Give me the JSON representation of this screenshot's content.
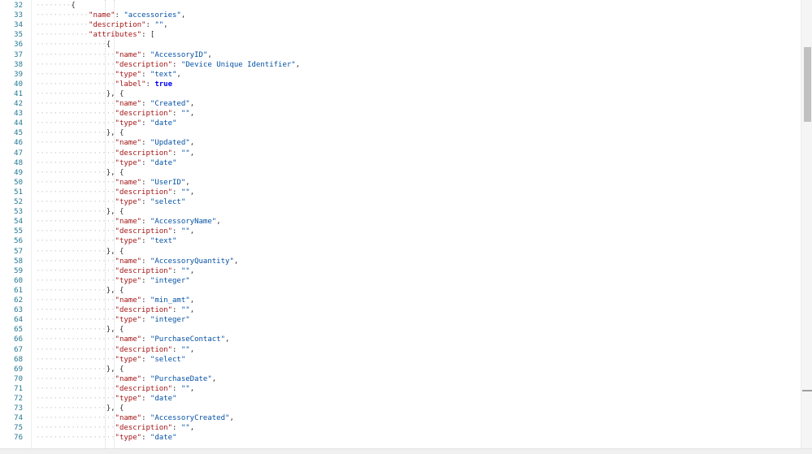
{
  "editor": {
    "lines": [
      {
        "n": "32",
        "indent": 8,
        "parts": [
          {
            "t": "p",
            "v": "{"
          }
        ]
      },
      {
        "n": "33",
        "indent": 12,
        "parts": [
          {
            "t": "k",
            "v": "\"name\""
          },
          {
            "t": "p",
            "v": ": "
          },
          {
            "t": "s",
            "v": "\"accessories\""
          },
          {
            "t": "p",
            "v": ","
          }
        ]
      },
      {
        "n": "34",
        "indent": 12,
        "parts": [
          {
            "t": "k",
            "v": "\"description\""
          },
          {
            "t": "p",
            "v": ": "
          },
          {
            "t": "s",
            "v": "\"\""
          },
          {
            "t": "p",
            "v": ","
          }
        ]
      },
      {
        "n": "35",
        "indent": 12,
        "parts": [
          {
            "t": "k",
            "v": "\"attributes\""
          },
          {
            "t": "p",
            "v": ": ["
          }
        ]
      },
      {
        "n": "36",
        "indent": 16,
        "parts": [
          {
            "t": "p",
            "v": "{"
          }
        ]
      },
      {
        "n": "37",
        "indent": 18,
        "parts": [
          {
            "t": "k",
            "v": "\"name\""
          },
          {
            "t": "p",
            "v": ": "
          },
          {
            "t": "s",
            "v": "\"AccessoryID\""
          },
          {
            "t": "p",
            "v": ","
          }
        ]
      },
      {
        "n": "38",
        "indent": 18,
        "parts": [
          {
            "t": "k",
            "v": "\"description\""
          },
          {
            "t": "p",
            "v": ": "
          },
          {
            "t": "s",
            "v": "\"Device Unique Identifier\""
          },
          {
            "t": "p",
            "v": ","
          }
        ]
      },
      {
        "n": "39",
        "indent": 18,
        "parts": [
          {
            "t": "k",
            "v": "\"type\""
          },
          {
            "t": "p",
            "v": ": "
          },
          {
            "t": "s",
            "v": "\"text\""
          },
          {
            "t": "p",
            "v": ","
          }
        ]
      },
      {
        "n": "40",
        "indent": 18,
        "parts": [
          {
            "t": "k",
            "v": "\"label\""
          },
          {
            "t": "p",
            "v": ": "
          },
          {
            "t": "b",
            "v": "true"
          }
        ]
      },
      {
        "n": "41",
        "indent": 16,
        "parts": [
          {
            "t": "p",
            "v": "}, {"
          }
        ]
      },
      {
        "n": "42",
        "indent": 18,
        "parts": [
          {
            "t": "k",
            "v": "\"name\""
          },
          {
            "t": "p",
            "v": ": "
          },
          {
            "t": "s",
            "v": "\"Created\""
          },
          {
            "t": "p",
            "v": ","
          }
        ]
      },
      {
        "n": "43",
        "indent": 18,
        "parts": [
          {
            "t": "k",
            "v": "\"description\""
          },
          {
            "t": "p",
            "v": ": "
          },
          {
            "t": "s",
            "v": "\"\""
          },
          {
            "t": "p",
            "v": ","
          }
        ]
      },
      {
        "n": "44",
        "indent": 18,
        "parts": [
          {
            "t": "k",
            "v": "\"type\""
          },
          {
            "t": "p",
            "v": ": "
          },
          {
            "t": "s",
            "v": "\"date\""
          }
        ]
      },
      {
        "n": "45",
        "indent": 16,
        "parts": [
          {
            "t": "p",
            "v": "}, {"
          }
        ]
      },
      {
        "n": "46",
        "indent": 18,
        "parts": [
          {
            "t": "k",
            "v": "\"name\""
          },
          {
            "t": "p",
            "v": ": "
          },
          {
            "t": "s",
            "v": "\"Updated\""
          },
          {
            "t": "p",
            "v": ","
          }
        ]
      },
      {
        "n": "47",
        "indent": 18,
        "parts": [
          {
            "t": "k",
            "v": "\"description\""
          },
          {
            "t": "p",
            "v": ": "
          },
          {
            "t": "s",
            "v": "\"\""
          },
          {
            "t": "p",
            "v": ","
          }
        ]
      },
      {
        "n": "48",
        "indent": 18,
        "parts": [
          {
            "t": "k",
            "v": "\"type\""
          },
          {
            "t": "p",
            "v": ": "
          },
          {
            "t": "s",
            "v": "\"date\""
          }
        ]
      },
      {
        "n": "49",
        "indent": 16,
        "parts": [
          {
            "t": "p",
            "v": "}, {"
          }
        ]
      },
      {
        "n": "50",
        "indent": 18,
        "parts": [
          {
            "t": "k",
            "v": "\"name\""
          },
          {
            "t": "p",
            "v": ": "
          },
          {
            "t": "s",
            "v": "\"UserID\""
          },
          {
            "t": "p",
            "v": ","
          }
        ]
      },
      {
        "n": "51",
        "indent": 18,
        "parts": [
          {
            "t": "k",
            "v": "\"description\""
          },
          {
            "t": "p",
            "v": ": "
          },
          {
            "t": "s",
            "v": "\"\""
          },
          {
            "t": "p",
            "v": ","
          }
        ]
      },
      {
        "n": "52",
        "indent": 18,
        "parts": [
          {
            "t": "k",
            "v": "\"type\""
          },
          {
            "t": "p",
            "v": ": "
          },
          {
            "t": "s",
            "v": "\"select\""
          }
        ]
      },
      {
        "n": "53",
        "indent": 16,
        "parts": [
          {
            "t": "p",
            "v": "}, {"
          }
        ]
      },
      {
        "n": "54",
        "indent": 18,
        "parts": [
          {
            "t": "k",
            "v": "\"name\""
          },
          {
            "t": "p",
            "v": ": "
          },
          {
            "t": "s",
            "v": "\"AccessoryName\""
          },
          {
            "t": "p",
            "v": ","
          }
        ]
      },
      {
        "n": "55",
        "indent": 18,
        "parts": [
          {
            "t": "k",
            "v": "\"description\""
          },
          {
            "t": "p",
            "v": ": "
          },
          {
            "t": "s",
            "v": "\"\""
          },
          {
            "t": "p",
            "v": ","
          }
        ]
      },
      {
        "n": "56",
        "indent": 18,
        "parts": [
          {
            "t": "k",
            "v": "\"type\""
          },
          {
            "t": "p",
            "v": ": "
          },
          {
            "t": "s",
            "v": "\"text\""
          }
        ]
      },
      {
        "n": "57",
        "indent": 16,
        "parts": [
          {
            "t": "p",
            "v": "}, {"
          }
        ]
      },
      {
        "n": "58",
        "indent": 18,
        "parts": [
          {
            "t": "k",
            "v": "\"name\""
          },
          {
            "t": "p",
            "v": ": "
          },
          {
            "t": "s",
            "v": "\"AccessoryQuantity\""
          },
          {
            "t": "p",
            "v": ","
          }
        ]
      },
      {
        "n": "59",
        "indent": 18,
        "parts": [
          {
            "t": "k",
            "v": "\"description\""
          },
          {
            "t": "p",
            "v": ": "
          },
          {
            "t": "s",
            "v": "\"\""
          },
          {
            "t": "p",
            "v": ","
          }
        ]
      },
      {
        "n": "60",
        "indent": 18,
        "parts": [
          {
            "t": "k",
            "v": "\"type\""
          },
          {
            "t": "p",
            "v": ": "
          },
          {
            "t": "s",
            "v": "\"integer\""
          }
        ]
      },
      {
        "n": "61",
        "indent": 16,
        "parts": [
          {
            "t": "p",
            "v": "}, {"
          }
        ]
      },
      {
        "n": "62",
        "indent": 18,
        "parts": [
          {
            "t": "k",
            "v": "\"name\""
          },
          {
            "t": "p",
            "v": ": "
          },
          {
            "t": "s",
            "v": "\"min_amt\""
          },
          {
            "t": "p",
            "v": ","
          }
        ]
      },
      {
        "n": "63",
        "indent": 18,
        "parts": [
          {
            "t": "k",
            "v": "\"description\""
          },
          {
            "t": "p",
            "v": ": "
          },
          {
            "t": "s",
            "v": "\"\""
          },
          {
            "t": "p",
            "v": ","
          }
        ]
      },
      {
        "n": "64",
        "indent": 18,
        "parts": [
          {
            "t": "k",
            "v": "\"type\""
          },
          {
            "t": "p",
            "v": ": "
          },
          {
            "t": "s",
            "v": "\"integer\""
          }
        ]
      },
      {
        "n": "65",
        "indent": 16,
        "parts": [
          {
            "t": "p",
            "v": "}, {"
          }
        ]
      },
      {
        "n": "66",
        "indent": 18,
        "parts": [
          {
            "t": "k",
            "v": "\"name\""
          },
          {
            "t": "p",
            "v": ": "
          },
          {
            "t": "s",
            "v": "\"PurchaseContact\""
          },
          {
            "t": "p",
            "v": ","
          }
        ]
      },
      {
        "n": "67",
        "indent": 18,
        "parts": [
          {
            "t": "k",
            "v": "\"description\""
          },
          {
            "t": "p",
            "v": ": "
          },
          {
            "t": "s",
            "v": "\"\""
          },
          {
            "t": "p",
            "v": ","
          }
        ]
      },
      {
        "n": "68",
        "indent": 18,
        "parts": [
          {
            "t": "k",
            "v": "\"type\""
          },
          {
            "t": "p",
            "v": ": "
          },
          {
            "t": "s",
            "v": "\"select\""
          }
        ]
      },
      {
        "n": "69",
        "indent": 16,
        "parts": [
          {
            "t": "p",
            "v": "}, {"
          }
        ]
      },
      {
        "n": "70",
        "indent": 18,
        "parts": [
          {
            "t": "k",
            "v": "\"name\""
          },
          {
            "t": "p",
            "v": ": "
          },
          {
            "t": "s",
            "v": "\"PurchaseDate\""
          },
          {
            "t": "p",
            "v": ","
          }
        ]
      },
      {
        "n": "71",
        "indent": 18,
        "parts": [
          {
            "t": "k",
            "v": "\"description\""
          },
          {
            "t": "p",
            "v": ": "
          },
          {
            "t": "s",
            "v": "\"\""
          },
          {
            "t": "p",
            "v": ","
          }
        ]
      },
      {
        "n": "72",
        "indent": 18,
        "parts": [
          {
            "t": "k",
            "v": "\"type\""
          },
          {
            "t": "p",
            "v": ": "
          },
          {
            "t": "s",
            "v": "\"date\""
          }
        ]
      },
      {
        "n": "73",
        "indent": 16,
        "parts": [
          {
            "t": "p",
            "v": "}, {"
          }
        ]
      },
      {
        "n": "74",
        "indent": 18,
        "parts": [
          {
            "t": "k",
            "v": "\"name\""
          },
          {
            "t": "p",
            "v": ": "
          },
          {
            "t": "s",
            "v": "\"AccessoryCreated\""
          },
          {
            "t": "p",
            "v": ","
          }
        ]
      },
      {
        "n": "75",
        "indent": 18,
        "parts": [
          {
            "t": "k",
            "v": "\"description\""
          },
          {
            "t": "p",
            "v": ": "
          },
          {
            "t": "s",
            "v": "\"\""
          },
          {
            "t": "p",
            "v": ","
          }
        ]
      },
      {
        "n": "76",
        "indent": 18,
        "parts": [
          {
            "t": "k",
            "v": "\"type\""
          },
          {
            "t": "p",
            "v": ": "
          },
          {
            "t": "s",
            "v": "\"date\""
          }
        ]
      }
    ]
  }
}
